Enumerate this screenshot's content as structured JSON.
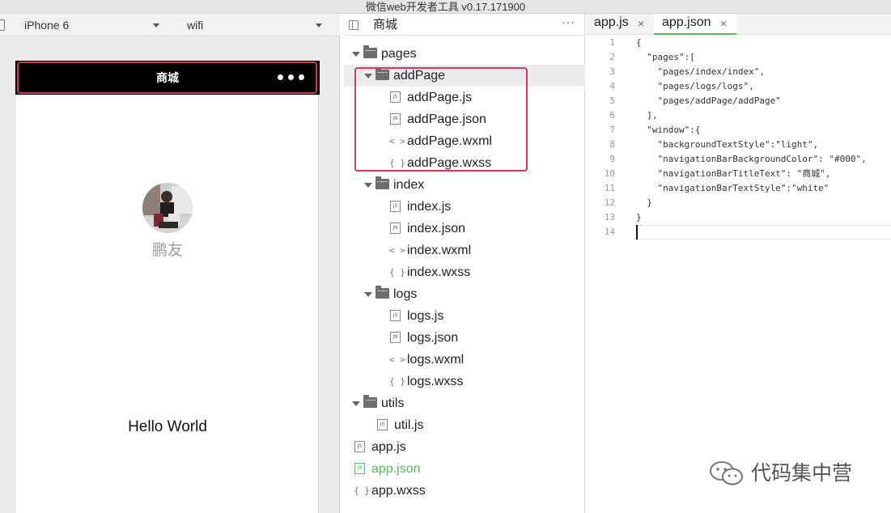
{
  "window": {
    "title": "微信web开发者工具 v0.17.171900"
  },
  "simulator": {
    "device": "iPhone 6",
    "network": "wifi",
    "page": {
      "nav_title": "商城",
      "nickname": "鹏友",
      "greeting": "Hello World",
      "nav_background": "#000000",
      "nav_text_color": "#ffffff"
    }
  },
  "file_tree": {
    "title": "商城",
    "more": "···",
    "items": [
      {
        "label": "pages",
        "type": "folder",
        "level": 0
      },
      {
        "label": "addPage",
        "type": "folder",
        "level": 1,
        "selected": true
      },
      {
        "label": "addPage.js",
        "type": "js",
        "icon": "JS",
        "level": 2
      },
      {
        "label": "addPage.json",
        "type": "json",
        "icon": "JN",
        "level": 2
      },
      {
        "label": "addPage.wxml",
        "type": "wxml",
        "icon": "< >",
        "level": 2
      },
      {
        "label": "addPage.wxss",
        "type": "wxss",
        "icon": "{ }",
        "level": 2
      },
      {
        "label": "index",
        "type": "folder",
        "level": 1
      },
      {
        "label": "index.js",
        "type": "js",
        "icon": "JS",
        "level": 2
      },
      {
        "label": "index.json",
        "type": "json",
        "icon": "JN",
        "level": 2
      },
      {
        "label": "index.wxml",
        "type": "wxml",
        "icon": "< >",
        "level": 2
      },
      {
        "label": "index.wxss",
        "type": "wxss",
        "icon": "{ }",
        "level": 2
      },
      {
        "label": "logs",
        "type": "folder",
        "level": 1
      },
      {
        "label": "logs.js",
        "type": "js",
        "icon": "JS",
        "level": 2
      },
      {
        "label": "logs.json",
        "type": "json",
        "icon": "JN",
        "level": 2
      },
      {
        "label": "logs.wxml",
        "type": "wxml",
        "icon": "< >",
        "level": 2
      },
      {
        "label": "logs.wxss",
        "type": "wxss",
        "icon": "{ }",
        "level": 2
      },
      {
        "label": "utils",
        "type": "folder",
        "level": 0
      },
      {
        "label": "util.js",
        "type": "js",
        "icon": "JS",
        "level": 1
      },
      {
        "label": "app.js",
        "type": "js",
        "icon": "JS",
        "level": 0
      },
      {
        "label": "app.json",
        "type": "json",
        "icon": "JN",
        "level": 0,
        "active": true
      },
      {
        "label": "app.wxss",
        "type": "wxss",
        "icon": "{ }",
        "level": 0
      }
    ]
  },
  "editor": {
    "tabs": [
      {
        "label": "app.js",
        "close": "×"
      },
      {
        "label": "app.json",
        "close": "×",
        "active": true
      }
    ],
    "lines": [
      "{",
      "  \"pages\":[",
      "    \"pages/index/index\",",
      "    \"pages/logs/logs\",",
      "    \"pages/addPage/addPage\"",
      "  ],",
      "  \"window\":{",
      "    \"backgroundTextStyle\":\"light\",",
      "    \"navigationBarBackgroundColor\": \"#000\",",
      "    \"navigationBarTitleText\": \"商城\",",
      "    \"navigationBarTextStyle\":\"white\"",
      "  }",
      "}",
      ""
    ]
  },
  "watermark": {
    "text": "代码集中营"
  },
  "colors": {
    "highlight_red": "#cc3d5a",
    "active_green": "#5cb85c"
  }
}
